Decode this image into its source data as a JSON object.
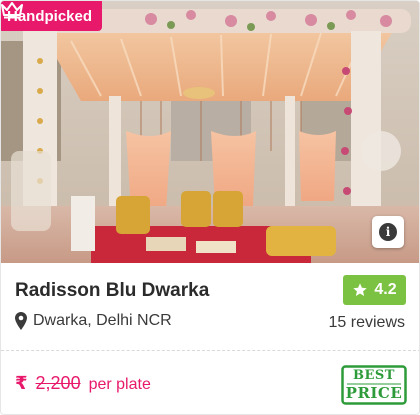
{
  "badge": {
    "label": "Handpicked",
    "icon": "crown-icon"
  },
  "photo": {
    "alt_icon": "info-icon"
  },
  "venue": {
    "name": "Radisson Blu Dwarka",
    "rating": "4.2",
    "location": "Dwarka, Delhi NCR",
    "reviews": "15 reviews"
  },
  "pricing": {
    "currency_symbol": "₹",
    "amount": "2,200",
    "unit": "per plate"
  },
  "best_price_stamp": {
    "line1": "BEST",
    "line2": "PRICE"
  },
  "colors": {
    "brand": "#e8196b",
    "rating_bg": "#7cc242",
    "best_price": "#2e9b3a"
  }
}
